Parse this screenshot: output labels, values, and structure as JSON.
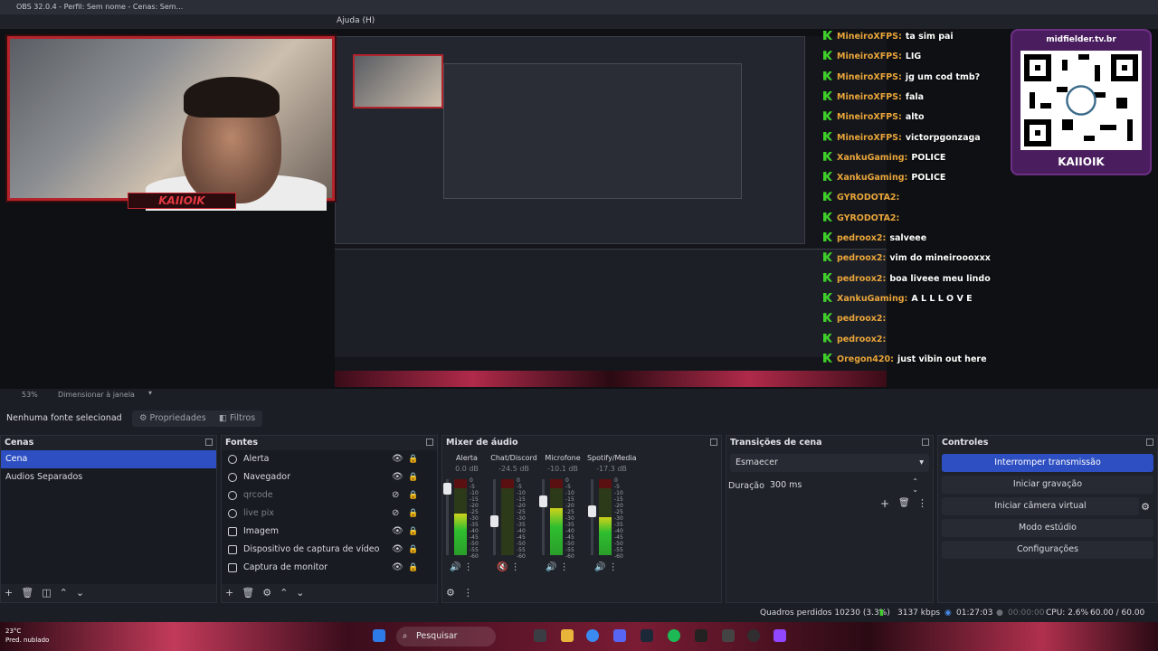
{
  "window": {
    "title": "OBS 32.0.4 - Perfil: Sem nome - Cenas: Sem...",
    "menu_help": "Ajuda (H)"
  },
  "preview": {
    "cam_label": "KAIIOIK",
    "zoom": "53%",
    "resize_label": "Dimensionar à janela",
    "qr_url": "midfielder.tv.br",
    "qr_name": "KAIIOIK",
    "chat": [
      {
        "user": "MineiroXFPS:",
        "msg": "ta sim pai"
      },
      {
        "user": "MineiroXFPS:",
        "msg": "LIG"
      },
      {
        "user": "MineiroXFPS:",
        "msg": "jg um cod tmb?"
      },
      {
        "user": "MineiroXFPS:",
        "msg": "fala"
      },
      {
        "user": "MineiroXFPS:",
        "msg": "alto"
      },
      {
        "user": "MineiroXFPS:",
        "msg": "victorpgonzaga"
      },
      {
        "user": "XankuGaming:",
        "msg": "POLICE"
      },
      {
        "user": "XankuGaming:",
        "msg": "POLICE"
      },
      {
        "user": "GYRODOTA2:",
        "msg": ""
      },
      {
        "user": "GYRODOTA2:",
        "msg": ""
      },
      {
        "user": "pedroox2:",
        "msg": "salveee"
      },
      {
        "user": "pedroox2:",
        "msg": "vim do mineiroooxxx"
      },
      {
        "user": "pedroox2:",
        "msg": "boa liveee meu lindo"
      },
      {
        "user": "XankuGaming:",
        "msg": "A L L L O V E"
      },
      {
        "user": "pedroox2:",
        "msg": ""
      },
      {
        "user": "pedroox2:",
        "msg": ""
      },
      {
        "user": "Oregon420:",
        "msg": "just vibin out here"
      }
    ]
  },
  "source_bar": {
    "none_selected": "Nenhuma fonte selecionad",
    "properties": "Propriedades",
    "filters": "Filtros"
  },
  "scenes": {
    "title": "Cenas",
    "items": [
      "Cena",
      "Audios Separados"
    ],
    "selected": 0
  },
  "sources": {
    "title": "Fontes",
    "items": [
      {
        "label": "Alerta",
        "icon": "browser-icon",
        "visible": true
      },
      {
        "label": "Navegador",
        "icon": "browser-icon",
        "visible": true
      },
      {
        "label": "qrcode",
        "icon": "browser-icon",
        "visible": false
      },
      {
        "label": "live pix",
        "icon": "browser-icon",
        "visible": false
      },
      {
        "label": "Imagem",
        "icon": "image-icon",
        "visible": true
      },
      {
        "label": "Dispositivo de captura de vídeo",
        "icon": "camera-icon",
        "visible": true
      },
      {
        "label": "Captura de monitor",
        "icon": "monitor-icon",
        "visible": true
      }
    ]
  },
  "mixer": {
    "title": "Mixer de áudio",
    "channels": [
      {
        "name": "Alerta",
        "db": "0.0 dB",
        "level": 0.55,
        "fader": 0.95,
        "muted": false
      },
      {
        "name": "Chat/Discord",
        "db": "-24.5 dB",
        "level": 0.0,
        "fader": 0.45,
        "muted": true
      },
      {
        "name": "Microfone",
        "db": "-10.1 dB",
        "level": 0.62,
        "fader": 0.75,
        "muted": false
      },
      {
        "name": "Spotify/Media",
        "db": "-17.3 dB",
        "level": 0.5,
        "fader": 0.6,
        "muted": false
      }
    ],
    "ticks": [
      "0",
      "-5",
      "-10",
      "-15",
      "-20",
      "-25",
      "-30",
      "-35",
      "-40",
      "-45",
      "-50",
      "-55",
      "-60"
    ]
  },
  "transitions": {
    "title": "Transições de cena",
    "selected": "Esmaecer",
    "duration_label": "Duração",
    "duration": "300 ms"
  },
  "controls": {
    "title": "Controles",
    "buttons": [
      "Interromper transmissão",
      "Iniciar gravação",
      "Iniciar câmera virtual",
      "Modo estúdio",
      "Configurações"
    ]
  },
  "status": {
    "dropped": "Quadros perdidos 10230 (3.3%)",
    "bitrate": "3137 kbps",
    "stream_time": "01:27:03",
    "rec_time": "00:00:00",
    "cpu": "CPU: 2.6%",
    "fps": "60.00 / 60.00 FPS"
  },
  "taskbar": {
    "search": "Pesquisar",
    "weather_temp": "23°C",
    "weather_desc": "Pred. nublado"
  },
  "colors": {
    "accent": "#2d4fc2",
    "chat_user": "#e9a53a",
    "badge": "#3fcf2a",
    "live_red": "#b3242d"
  }
}
